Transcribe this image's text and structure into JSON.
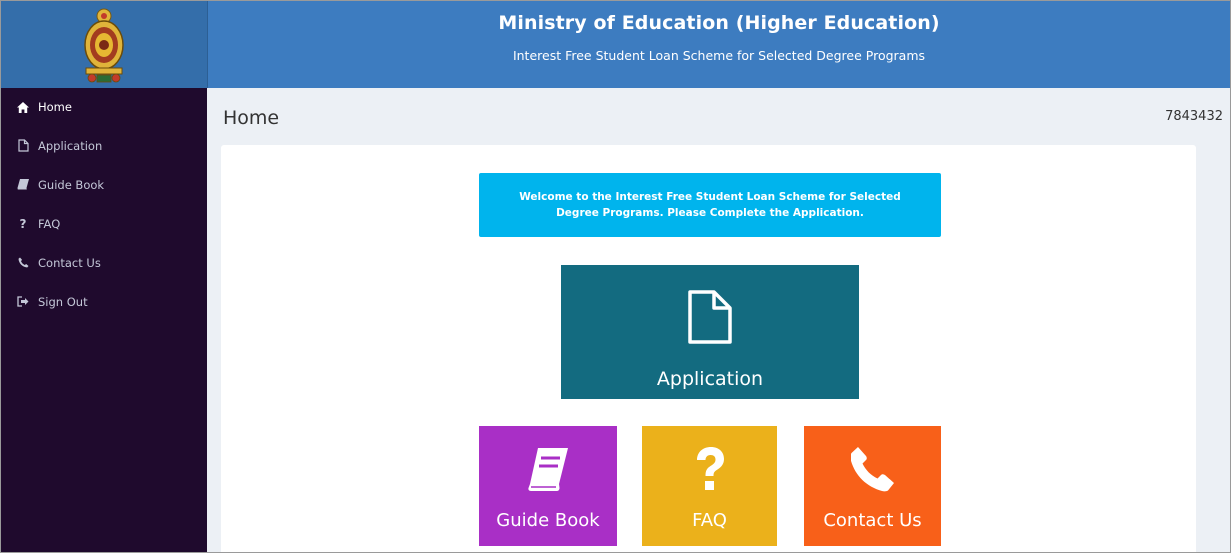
{
  "header": {
    "title": "Ministry of Education (Higher Education)",
    "subtitle": "Interest Free Student Loan Scheme for Selected Degree Programs",
    "logo_icon": "emblem-of-sri-lanka-icon"
  },
  "sidebar": {
    "items": [
      {
        "label": "Home",
        "icon": "home-icon",
        "active": true
      },
      {
        "label": "Application",
        "icon": "file-icon"
      },
      {
        "label": "Guide Book",
        "icon": "book-icon"
      },
      {
        "label": "FAQ",
        "icon": "question-icon"
      },
      {
        "label": "Contact Us",
        "icon": "phone-icon"
      },
      {
        "label": "Sign Out",
        "icon": "sign-out-icon"
      }
    ]
  },
  "content": {
    "page_title": "Home",
    "user_id": "7843432",
    "welcome_message": "Welcome to the Interest Free Student Loan Scheme for Selected Degree Programs. Please Complete the Application."
  },
  "tiles": {
    "application": {
      "label": "Application",
      "icon": "file-icon",
      "color": "#136b80"
    },
    "guide_book": {
      "label": "Guide Book",
      "icon": "book-icon",
      "color": "#a92fc6"
    },
    "faq": {
      "label": "FAQ",
      "icon": "question-icon",
      "color": "#ebb11b"
    },
    "contact_us": {
      "label": "Contact Us",
      "icon": "phone-icon",
      "color": "#f86019"
    }
  },
  "colors": {
    "header": "#3d7cc0",
    "sidebar": "#1f0a2d",
    "welcome": "#00b4ed",
    "background": "#ecf0f5"
  }
}
